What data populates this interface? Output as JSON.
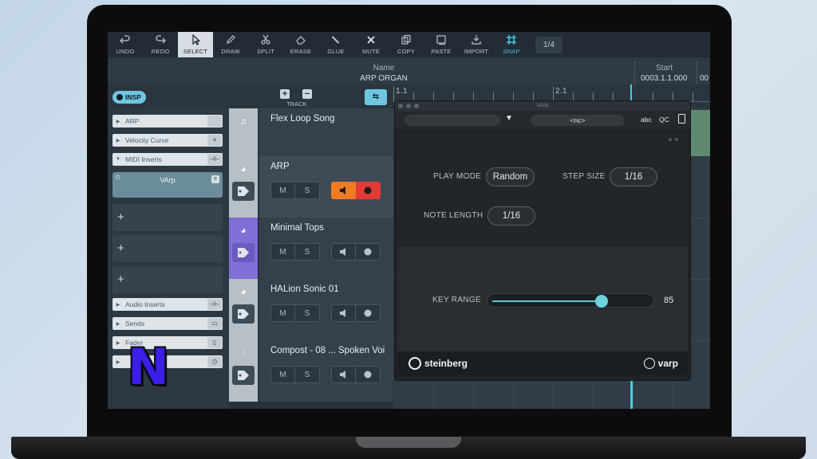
{
  "toolbar": {
    "tools": [
      {
        "key": "undo",
        "label": "UNDO",
        "active": false
      },
      {
        "key": "redo",
        "label": "REDO",
        "active": false
      },
      {
        "key": "select",
        "label": "SELECT",
        "active": true
      },
      {
        "key": "draw",
        "label": "DRAW",
        "active": false
      },
      {
        "key": "split",
        "label": "SPLIT",
        "active": false
      },
      {
        "key": "erase",
        "label": "ERASE",
        "active": false
      },
      {
        "key": "glue",
        "label": "GLUE",
        "active": false
      },
      {
        "key": "mute",
        "label": "MUTE",
        "active": false
      },
      {
        "key": "copy",
        "label": "COPY",
        "active": false
      },
      {
        "key": "paste",
        "label": "PASTE",
        "active": false
      },
      {
        "key": "import",
        "label": "IMPORT",
        "active": false
      },
      {
        "key": "snap",
        "label": "SNAP",
        "active": false
      }
    ],
    "page_indicator": "1/4"
  },
  "header": {
    "name_label": "Name",
    "name_value": "ARP ORGAN",
    "start_label": "Start",
    "start_value": "0003.1.1.000",
    "start_value_cut": "00"
  },
  "controls": {
    "insp_label": "INSP",
    "track_label": "TRACK",
    "ruler_marks": [
      "1.1",
      "2.1"
    ]
  },
  "inspector": {
    "arp_label": "ARP",
    "velocity_label": "Velocity Curve",
    "midi_inserts_label": "MIDI Inserts",
    "varp_slot_label": "VArp",
    "audio_inserts_label": "Audio Inserts",
    "sends_label": "Sends",
    "fader_label": "Fader",
    "empty_slot_symbol": "+"
  },
  "tracks": [
    {
      "name": "Flex Loop Song",
      "kind": "song"
    },
    {
      "name": "ARP",
      "kind": "instrument",
      "monitor_on": true,
      "record_on": true,
      "selected": true
    },
    {
      "name": "Minimal Tops",
      "kind": "instrument",
      "color_selected": true
    },
    {
      "name": "HALion Sonic 01",
      "kind": "instrument"
    },
    {
      "name": "Compost - 08 ... Spoken Voi",
      "kind": "audio"
    }
  ],
  "track_buttons": {
    "mute": "M",
    "solo": "S"
  },
  "varp": {
    "window_title": "VArp",
    "preset_value": "<nc>",
    "abc_label": "abc",
    "qc_label": "QC",
    "play_mode_label": "PLAY MODE",
    "play_mode_value": "Random",
    "step_size_label": "STEP SIZE",
    "step_size_value": "1/16",
    "note_length_label": "NOTE LENGTH",
    "note_length_value": "1/16",
    "key_range_label": "KEY RANGE",
    "key_range_value": "85",
    "key_range_fraction": 0.71,
    "brand_left": "steinberg",
    "brand_right": "varp"
  },
  "overlay": {
    "logo_letter": "N"
  },
  "colors": {
    "accent": "#6fc6e1",
    "monitor": "#f07b24",
    "record": "#e33a35",
    "track_selected": "#7f6fd6"
  }
}
